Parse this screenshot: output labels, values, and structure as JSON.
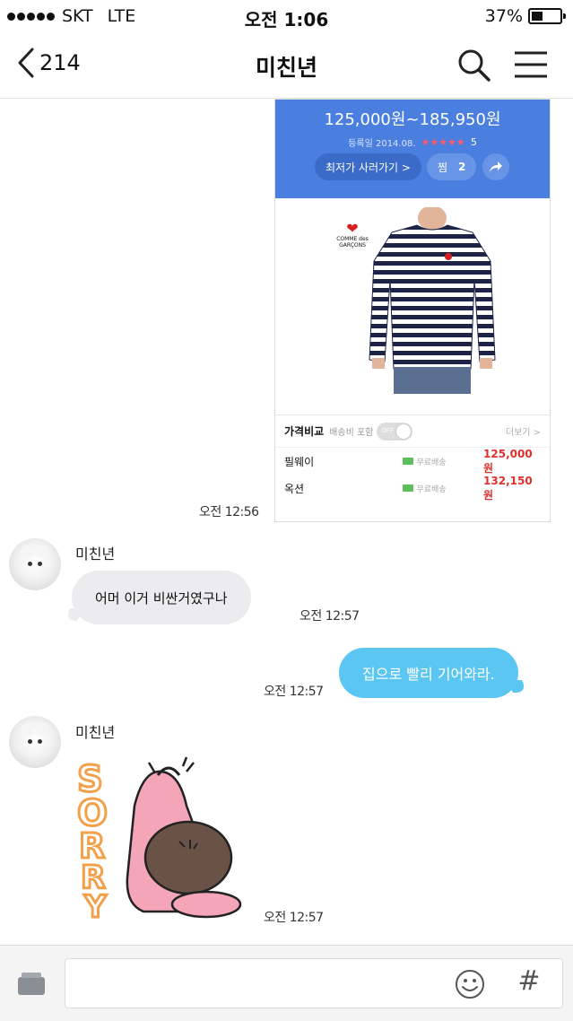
{
  "status_bar": {
    "carrier": "SKT",
    "network": "LTE",
    "time": "오전 1:06",
    "battery": "37%"
  },
  "nav": {
    "back_count": "214",
    "title": "미친년"
  },
  "product_card": {
    "price_range": "125,000원~185,950원",
    "reg_date": "등록일 2014.08.",
    "stars": "★★★★★",
    "rating": "5",
    "cheapest_label": "최저가 사러가기 >",
    "like_label": "찜",
    "like_count": "2",
    "brand_name": "COMME des GARÇONS",
    "compare_title": "가격비교",
    "shipping_label": "배송비 포함",
    "toggle_label": "OFF",
    "more_label": "더보기 >",
    "shops": [
      {
        "name": "필웨이",
        "shipping": "무료배송",
        "price": "125,000원"
      },
      {
        "name": "옥션",
        "shipping": "무료배송",
        "price": "132,150원"
      }
    ]
  },
  "messages": {
    "card_time": "오전 12:56",
    "sender": "미친년",
    "msg1_text": "어머 이거 비싼거였구나",
    "msg1_time": "오전 12:57",
    "msg2_text": "집으로 빨리 기어와라.",
    "msg2_time": "오전 12:57",
    "sticker_text": "SORRY",
    "sticker_time": "오전 12:57"
  },
  "input": {
    "placeholder": ""
  },
  "colors": {
    "accent_blue": "#4a7fe0",
    "bubble_out": "#5bc6f2",
    "bubble_in": "#ececef",
    "price_red": "#e0302b"
  }
}
